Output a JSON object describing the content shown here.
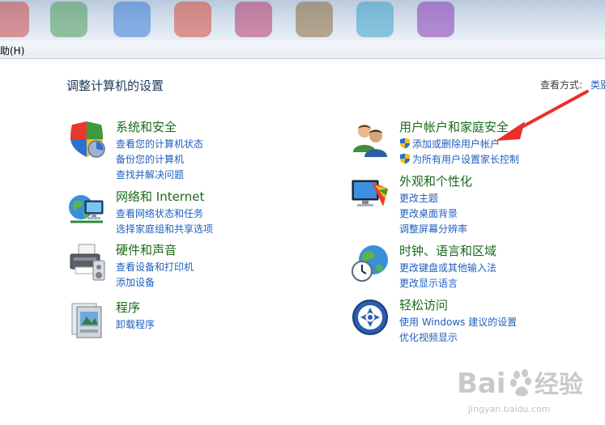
{
  "menu": {
    "help": "助(H)"
  },
  "heading": "调整计算机的设置",
  "view_by": {
    "label": "查看方式:",
    "value": "类别"
  },
  "categories": [
    {
      "title": "系统和安全",
      "icon": "shield-icon",
      "links": [
        "查看您的计算机状态",
        "备份您的计算机",
        "查找并解决问题"
      ]
    },
    {
      "title": "网络和 Internet",
      "icon": "network-globe-icon",
      "links": [
        "查看网络状态和任务",
        "选择家庭组和共享选项"
      ]
    },
    {
      "title": "硬件和声音",
      "icon": "printer-icon",
      "links": [
        "查看设备和打印机",
        "添加设备"
      ]
    },
    {
      "title": "程序",
      "icon": "programs-icon",
      "links": [
        "卸载程序"
      ]
    },
    {
      "title": "用户帐户和家庭安全",
      "icon": "users-icon",
      "links": [
        "添加或删除用户帐户",
        "为所有用户设置家长控制"
      ]
    },
    {
      "title": "外观和个性化",
      "icon": "display-palette-icon",
      "links": [
        "更改主题",
        "更改桌面背景",
        "调整屏幕分辨率"
      ]
    },
    {
      "title": "时钟、语言和区域",
      "icon": "clock-globe-icon",
      "links": [
        "更改键盘或其他输入法",
        "更改显示语言"
      ]
    },
    {
      "title": "轻松访问",
      "icon": "ease-of-access-icon",
      "links": [
        "使用 Windows 建议的设置",
        "优化视频显示"
      ]
    }
  ],
  "watermark": {
    "brand": "Bai",
    "brand2": "经验",
    "url": "jingyan.baidu.com"
  }
}
